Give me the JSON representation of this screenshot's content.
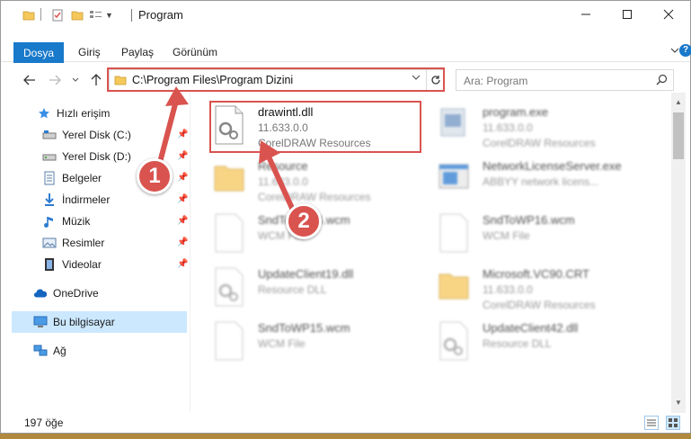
{
  "window": {
    "title": "Program",
    "controls": {
      "minimize": "minimize",
      "maximize": "maximize",
      "close": "close"
    }
  },
  "ribbon": {
    "file_tab": "Dosya",
    "tabs": [
      "Giriş",
      "Paylaş",
      "Görünüm"
    ]
  },
  "nav": {
    "address": "C:\\Program Files\\Program Dizini",
    "search_placeholder": "Ara: Program"
  },
  "sidebar": {
    "items": [
      {
        "label": "Hızlı erişim",
        "icon": "star-icon"
      },
      {
        "label": "Yerel Disk (C:)",
        "icon": "drive-icon"
      },
      {
        "label": "Yerel Disk (D:)",
        "icon": "drive-icon"
      },
      {
        "label": "Belgeler",
        "icon": "documents-icon"
      },
      {
        "label": "İndirmeler",
        "icon": "download-icon"
      },
      {
        "label": "Müzik",
        "icon": "music-icon"
      },
      {
        "label": "Resimler",
        "icon": "pictures-icon"
      },
      {
        "label": "Videolar",
        "icon": "video-icon"
      },
      {
        "label": "OneDrive",
        "icon": "cloud-icon"
      },
      {
        "label": "Bu bilgisayar",
        "icon": "computer-icon"
      },
      {
        "label": "Ağ",
        "icon": "network-icon"
      }
    ]
  },
  "files": [
    {
      "name": "drawintl.dll",
      "line1": "11.633.0.0",
      "line2": "CorelDRAW Resources"
    },
    {
      "name": "program.exe",
      "line1": "11.633.0.0",
      "line2": "CorelDRAW Resources"
    },
    {
      "name": "Resource",
      "line1": "11.633.0.0",
      "line2": "CorelDRAW Resources"
    },
    {
      "name": "NetworkLicenseServer.exe",
      "line1": "ABBYY network licens...",
      "line2": ""
    },
    {
      "name": "SndToWP14.wcm",
      "line1": "WCM File",
      "line2": ""
    },
    {
      "name": "SndToWP16.wcm",
      "line1": "WCM File",
      "line2": ""
    },
    {
      "name": "UpdateClient19.dll",
      "line1": "Resource DLL",
      "line2": ""
    },
    {
      "name": "Microsoft.VC90.CRT",
      "line1": "11.633.0.0",
      "line2": "CorelDRAW Resources"
    },
    {
      "name": "SndToWP15.wcm",
      "line1": "WCM File",
      "line2": ""
    },
    {
      "name": "UpdateClient42.dll",
      "line1": "Resource DLL",
      "line2": ""
    }
  ],
  "status": {
    "count": "197 öğe"
  },
  "callouts": {
    "one": "1",
    "two": "2"
  },
  "colors": {
    "accent": "#1979ca",
    "callout": "#d9534f",
    "selection": "#cce8ff"
  }
}
